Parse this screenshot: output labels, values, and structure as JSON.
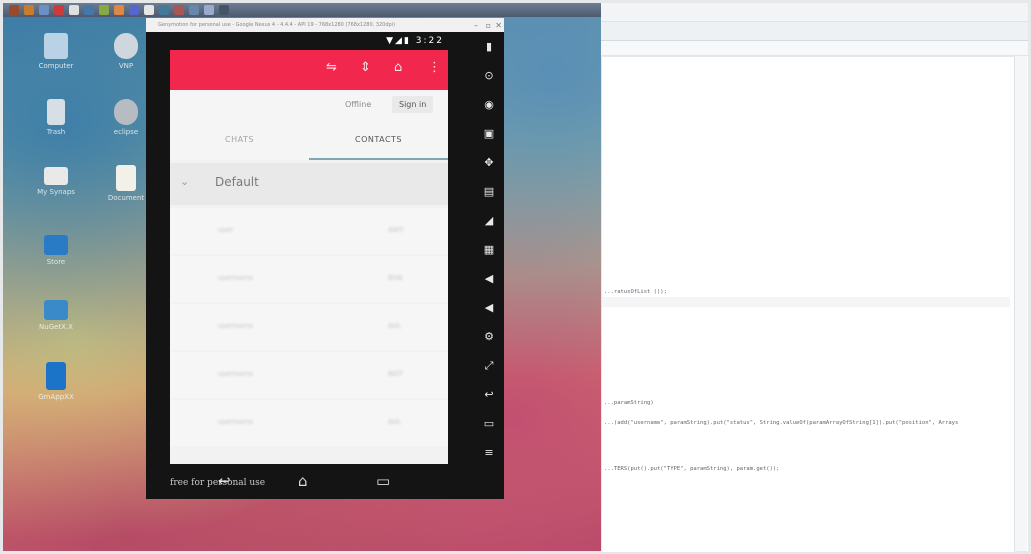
{
  "taskbar": {
    "icons": [
      "start-icon",
      "browser-icon",
      "files-icon",
      "terminal-icon",
      "app-icon-1",
      "app-icon-2",
      "app-icon-3",
      "app-icon-4",
      "app-icon-5",
      "app-icon-6",
      "app-icon-7",
      "app-icon-8",
      "app-icon-9",
      "app-icon-10",
      "app-icon-11"
    ],
    "colors": [
      "#9a4a2a",
      "#c87d2c",
      "#6a90c4",
      "#cc3b3b",
      "#e0e0e0",
      "#4477aa",
      "#88aa44",
      "#dd8844",
      "#5566cc",
      "#e6e6e6",
      "#447799",
      "#aa5555",
      "#6688aa",
      "#99aacc",
      "#445566"
    ]
  },
  "desktop": {
    "icons": [
      {
        "label": "Computer",
        "color": "#b9d2e6"
      },
      {
        "label": "VNP",
        "color": "#cfd6dd"
      },
      {
        "label": "Trash",
        "color": "#d6dee6"
      },
      {
        "label": "eclipse",
        "color": "#b7bcc2"
      },
      {
        "label": "My Synaps",
        "color": "#e9e9e9"
      },
      {
        "label": "Document",
        "color": "#f2f0e8"
      },
      {
        "label": "Store",
        "color": "#2a7bc6"
      },
      {
        "label": "NuGetX.X",
        "color": "#3a89c9"
      },
      {
        "label": "GmAppXX",
        "color": "#1c74c8"
      }
    ]
  },
  "emulator": {
    "title": "Genymotion for personal use - Google Nexus 4 - 4.4.4 - API 19 - 768x1280 (768x1280, 320dpi)",
    "time": "3:22",
    "app": {
      "offline_label": "Offline",
      "sign_in_label": "Sign in",
      "tabs": [
        "CHATS",
        "CONTACTS"
      ],
      "active_tab": "CONTACTS",
      "group": "Default",
      "contacts": [
        {
          "name": "user",
          "status": "AWY"
        },
        {
          "name": "username",
          "status": "BSN"
        },
        {
          "name": "username",
          "status": "AVL"
        },
        {
          "name": "username",
          "status": "NOT"
        },
        {
          "name": "username",
          "status": "AVL"
        }
      ],
      "accent_color": "#f2274d"
    },
    "watermark": "free for personal use",
    "side_tools": [
      "battery-icon",
      "gps-icon",
      "location-icon",
      "camera-icon",
      "move-icon",
      "id-icon",
      "rss-icon",
      "media-icon",
      "volume-up-icon",
      "volume-down-icon",
      "rotate-icon",
      "scale-icon",
      "back-icon",
      "home-icon",
      "menu-icon"
    ]
  },
  "ide": {
    "code_lines": [
      {
        "text": "...ratusOfList ());"
      },
      {
        "text": "...paramString)"
      },
      {
        "text": "...(add(\"username\", paramString).put(\"status\", String.valueOf(paramArrayOfString[1]).put(\"position\", Arrays"
      },
      {
        "text": "...TERS(put().put(\"TYPE\", paramString), param.get());"
      }
    ]
  }
}
